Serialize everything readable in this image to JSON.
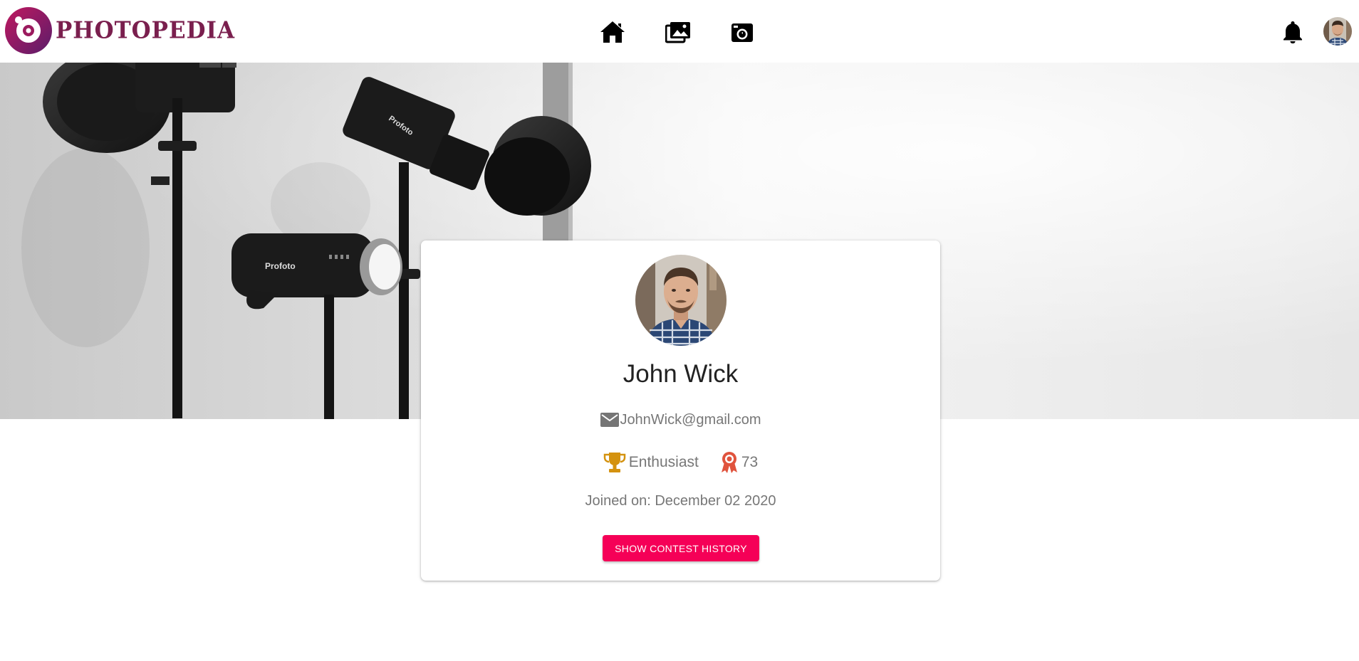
{
  "app": {
    "brand_name": "PHOTOPEDIA",
    "brand_color": "#7a1f4e",
    "logo_icon": "camera-lens-logo"
  },
  "nav": {
    "items": [
      {
        "icon": "home-icon"
      },
      {
        "icon": "photo-library-icon"
      },
      {
        "icon": "camera-contest-icon"
      }
    ],
    "notifications_icon": "bell-icon",
    "user_avatar_icon": "user-avatar"
  },
  "banner": {
    "image": "studio-lights-grayscale",
    "brand_labels": [
      "Profoto",
      "Profoto"
    ]
  },
  "profile": {
    "name": "John Wick",
    "email": "JohnWick@gmail.com",
    "email_icon": "mail-icon",
    "level_icon": "trophy-icon",
    "level": "Enthusiast",
    "badge_icon": "award-ribbon-icon",
    "points": "73",
    "joined": "Joined on: December 02 2020",
    "contest_button_label": "SHOW CONTEST HISTORY"
  },
  "colors": {
    "accent": "#f50057",
    "trophy": "#d4920f",
    "award": "#e0533d",
    "muted_text": "#777777"
  }
}
